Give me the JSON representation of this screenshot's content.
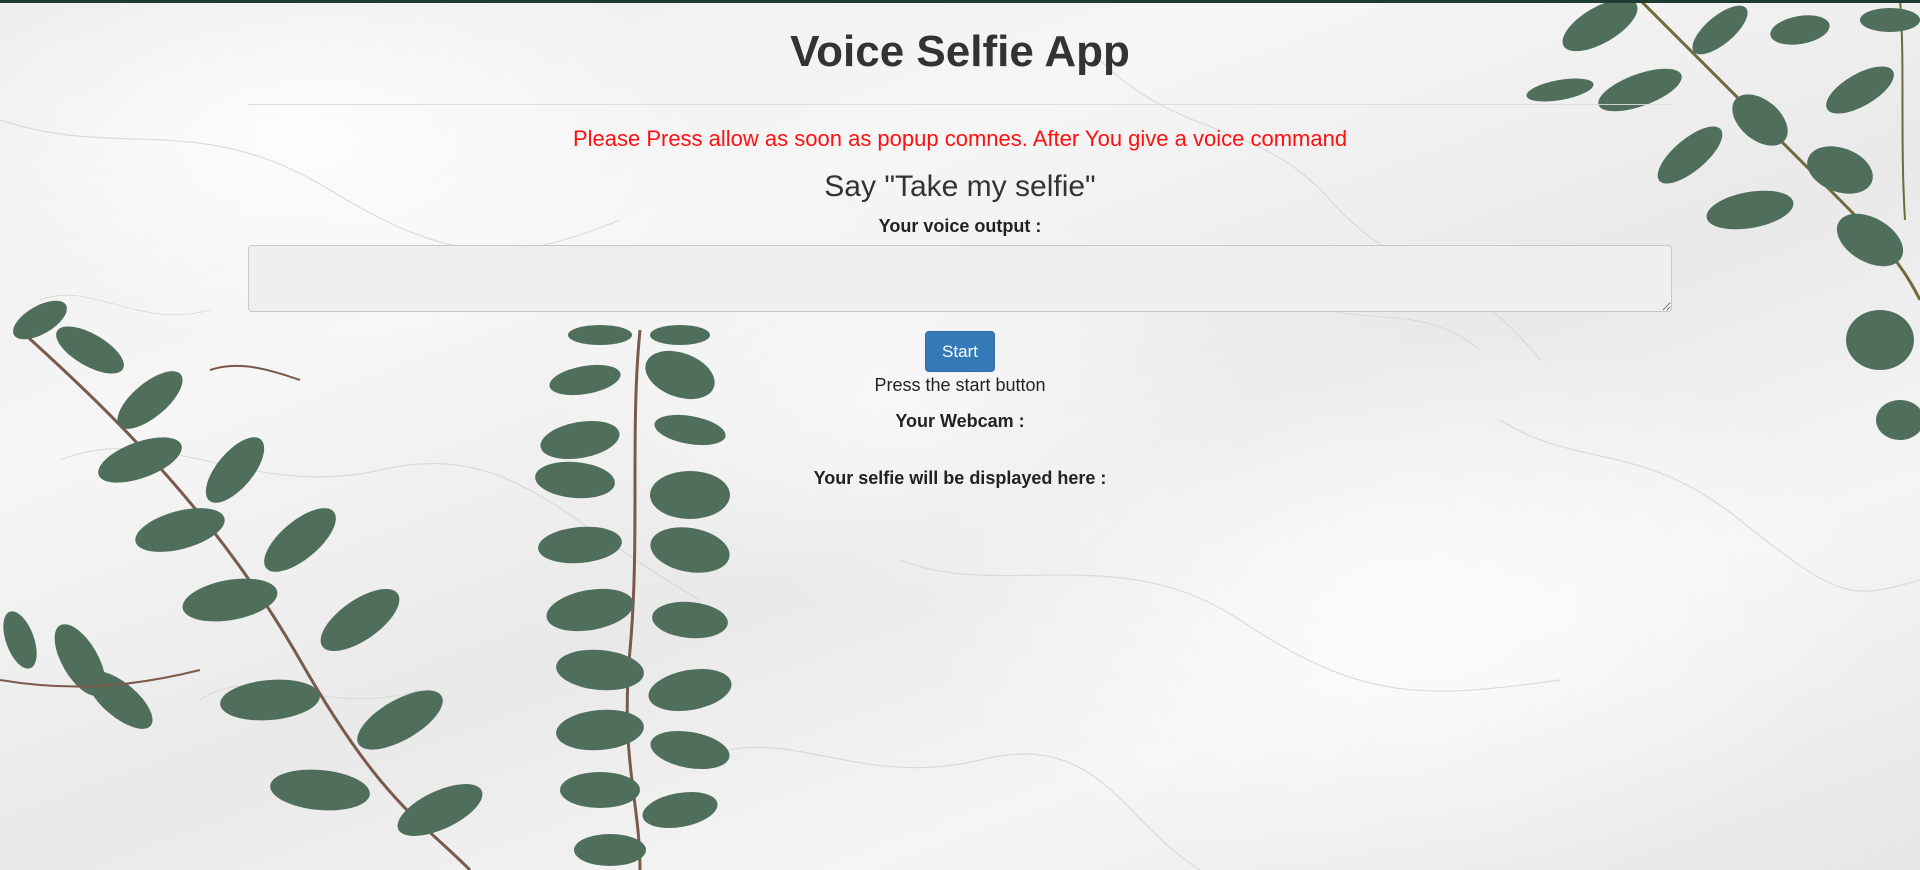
{
  "header": {
    "title": "Voice Selfie App"
  },
  "main": {
    "warning_text": "Please Press allow as soon as popup comnes. After You give a voice command",
    "say_heading": "Say \"Take my selfie\"",
    "voice_output_label": "Your voice output :",
    "voice_output_value": "",
    "start_button_label": "Start",
    "status_text": "Press the start button",
    "webcam_label": "Your Webcam :",
    "selfie_label": "Your selfie will be displayed here :"
  },
  "colors": {
    "warning": "#ff1010",
    "button": "#337ab7",
    "topbar": "#1f3b32"
  },
  "icons": {
    "background_decoration": "eucalyptus-leaves"
  }
}
